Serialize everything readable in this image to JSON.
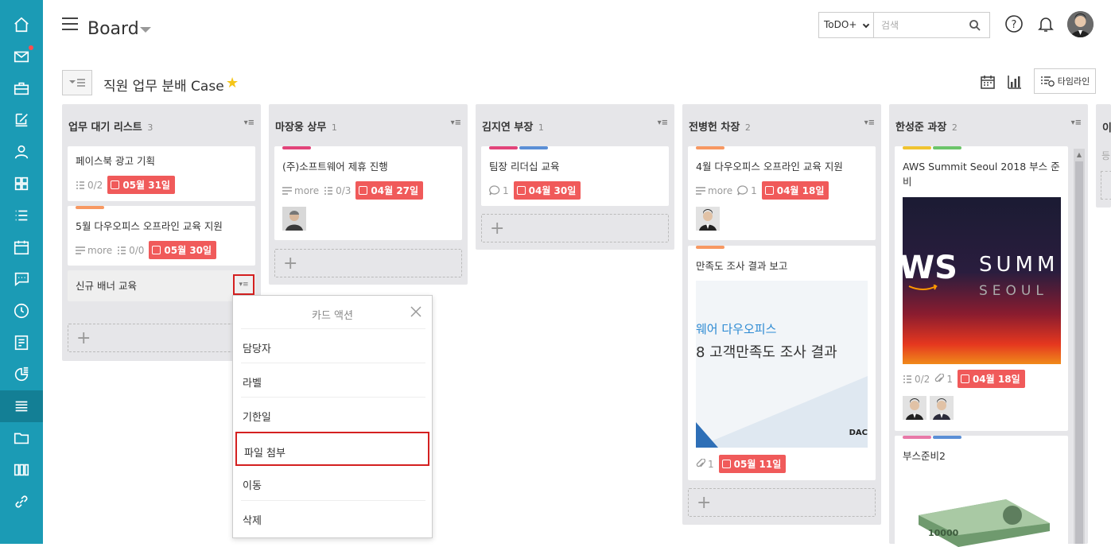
{
  "sidebar": {
    "items": [
      {
        "name": "home-icon"
      },
      {
        "name": "mail-icon"
      },
      {
        "name": "briefcase-icon"
      },
      {
        "name": "edit-icon"
      },
      {
        "name": "user-icon"
      },
      {
        "name": "grid-icon"
      },
      {
        "name": "list-icon"
      },
      {
        "name": "calendar-icon"
      },
      {
        "name": "chat-icon"
      },
      {
        "name": "clock-icon"
      },
      {
        "name": "document-icon"
      },
      {
        "name": "chart-icon"
      },
      {
        "name": "board-icon"
      },
      {
        "name": "folder-icon"
      },
      {
        "name": "apps-icon"
      },
      {
        "name": "link-icon"
      }
    ],
    "accent": "#1b9bb5",
    "active_color": "#137f95"
  },
  "topbar": {
    "title": "Board",
    "search": {
      "scope": "ToDO+",
      "placeholder": "검색"
    }
  },
  "subheader": {
    "project_title": "직원 업무 분배 Case",
    "star": "★",
    "timeline_label": "타임라인"
  },
  "columns": [
    {
      "title": "업무 대기 리스트",
      "count": "3",
      "cards": [
        {
          "title": "페이스북 광고 기획",
          "checklist": "0/2",
          "due": "05월 31일"
        },
        {
          "title": "5월 다우오피스 오프라인 교육 지원",
          "more": "more",
          "checklist": "0/0",
          "due": "05월 30일"
        },
        {
          "title": "신규 배너 교육"
        }
      ]
    },
    {
      "title": "마장웅 상무",
      "count": "1",
      "cards": [
        {
          "title": "(주)소프트웨어 제휴 진행",
          "more": "more",
          "checklist": "0/3",
          "due": "04월 27일"
        }
      ]
    },
    {
      "title": "김지연 부장",
      "count": "1",
      "cards": [
        {
          "title": "팀장 리더십 교육",
          "comments": "1",
          "due": "04월 30일"
        }
      ]
    },
    {
      "title": "전병헌 차장",
      "count": "2",
      "cards": [
        {
          "title": "4월 다우오피스 오프라인 교육 지원",
          "more": "more",
          "comments": "1",
          "due": "04월 18일"
        },
        {
          "title": "만족도 조사 결과 보고",
          "attachments": "1",
          "due": "05월 11일",
          "image_text_1": "웨어 다우오피스",
          "image_text_2": "8 고객만족도 조사 결과",
          "image_text_3": "DAC"
        }
      ]
    },
    {
      "title": "한성준 과장",
      "count": "2",
      "cards": [
        {
          "title": "AWS Summit Seoul 2018 부스 준비",
          "checklist": "0/2",
          "attachments": "1",
          "due": "04월 18일",
          "image_text_1": "WS",
          "image_text_2": "SUMM",
          "image_text_3": "SEOUL"
        },
        {
          "title": "부스준비2",
          "image_text_1": "10000"
        }
      ]
    },
    {
      "title": "이",
      "add_hint": "등"
    }
  ],
  "popup": {
    "title": "카드 액션",
    "items": [
      "담당자",
      "라벨",
      "기한일",
      "파일 첨부",
      "이동",
      "삭제"
    ]
  }
}
